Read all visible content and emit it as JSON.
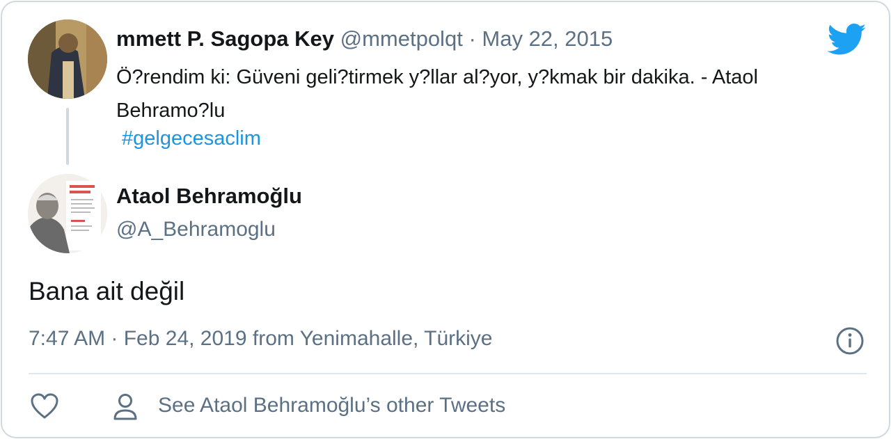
{
  "parent": {
    "name": "mmett P. Sagopa Key",
    "handle": "@mmetpolqt",
    "separator": "·",
    "date": "May 22, 2015",
    "text": "Ö?rendim ki: Güveni geli?tirmek y?llar al?yor, y?kmak bir dakika. - Ataol Behramo?lu",
    "hashtag": "#gelgecesaclim"
  },
  "author": {
    "name": "Ataol Behramoğlu",
    "handle": "@A_Behramoglu"
  },
  "tweet": {
    "text": "Bana ait değil",
    "meta": "7:47 AM · Feb 24, 2019 from Yenimahalle, Türkiye"
  },
  "actions": {
    "other_tweets_label": "See Ataol Behramoğlu’s other Tweets"
  },
  "icons": {
    "logo": "twitter-bird-icon",
    "info": "info-icon",
    "like": "heart-icon",
    "profile": "person-icon"
  },
  "colors": {
    "brand": "#1da1f2",
    "link": "#1b95e0",
    "secondary_text": "#5b7083"
  }
}
